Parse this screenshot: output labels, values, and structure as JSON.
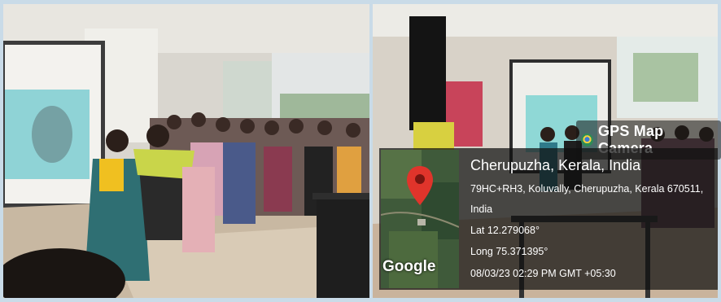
{
  "gps_overlay": {
    "brand": "GPS Map Camera",
    "location": "Cherupuzha, Kerala, India",
    "address": "79HC+RH3, Koluvally, Cherupuzha, Kerala 670511,",
    "country": "India",
    "latitude": "Lat 12.279068°",
    "longitude": "Long 75.371395°",
    "datetime": "08/03/23 02:29 PM GMT +05:30",
    "map_logo": "Google"
  },
  "photos": {
    "left": {
      "description_icon": "photo-assembly-projector"
    },
    "right": {
      "description_icon": "photo-projector-room"
    }
  },
  "colors": {
    "background": "#c9dbe8",
    "overlay": "#141414",
    "map_pin": "#e0342b"
  }
}
